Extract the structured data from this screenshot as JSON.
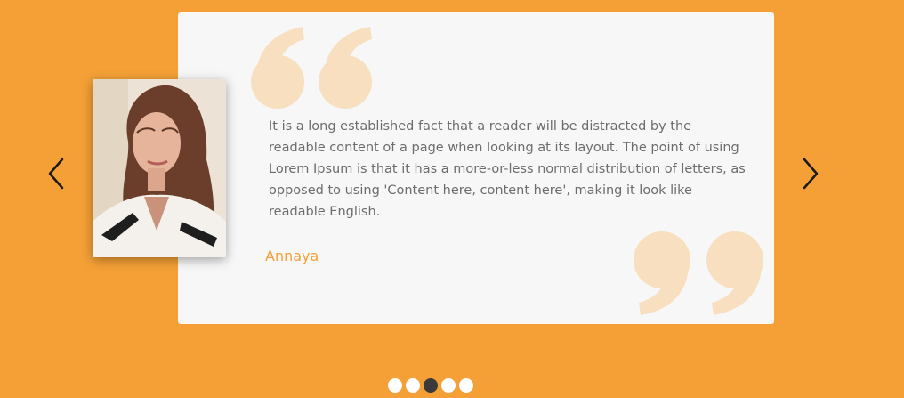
{
  "testimonial": {
    "quote": "It is a long established fact that a reader will be distracted by the readable content of a page when looking at its layout. The point of using Lorem Ipsum is that it has a more-or-less normal distribution of letters, as opposed to using 'Content here, content here', making it look like readable English.",
    "author": "Annaya"
  },
  "carousel": {
    "prev_icon": "chevron-left-icon",
    "next_icon": "chevron-right-icon",
    "dot_count": 5,
    "active_index": 2
  },
  "colors": {
    "background": "#f4a036",
    "card": "#f7f7f7",
    "quote_marks": "#f7dfc0",
    "text": "#6c6c6c",
    "author": "#f4a036",
    "dot": "#ffffff",
    "dot_active": "#3a3a3a"
  }
}
